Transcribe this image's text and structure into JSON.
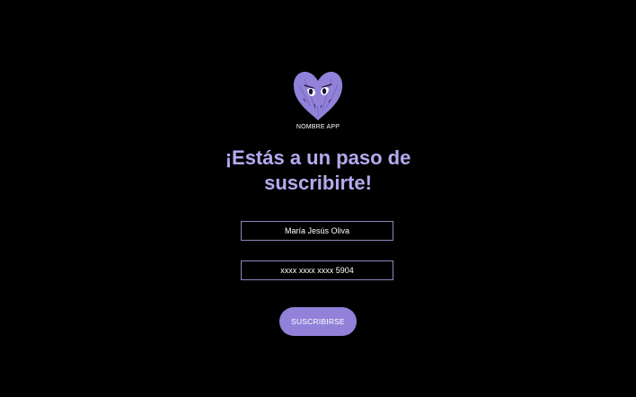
{
  "logo": {
    "icon": "heart-face-icon",
    "app_name": "NOMBRE APP",
    "color": "#9181d9"
  },
  "headline": {
    "line1": "¡Estás a un paso de",
    "line2": "suscribirte!"
  },
  "form": {
    "name_value": "María Jesús Oliva",
    "card_value": "xxxx xxxx xxxx 5904",
    "submit_label": "SUSCRIBIRSE"
  },
  "colors": {
    "background": "#000000",
    "accent": "#9181d9",
    "headline": "#b7a9ef",
    "field_border": "#8f86bd"
  }
}
